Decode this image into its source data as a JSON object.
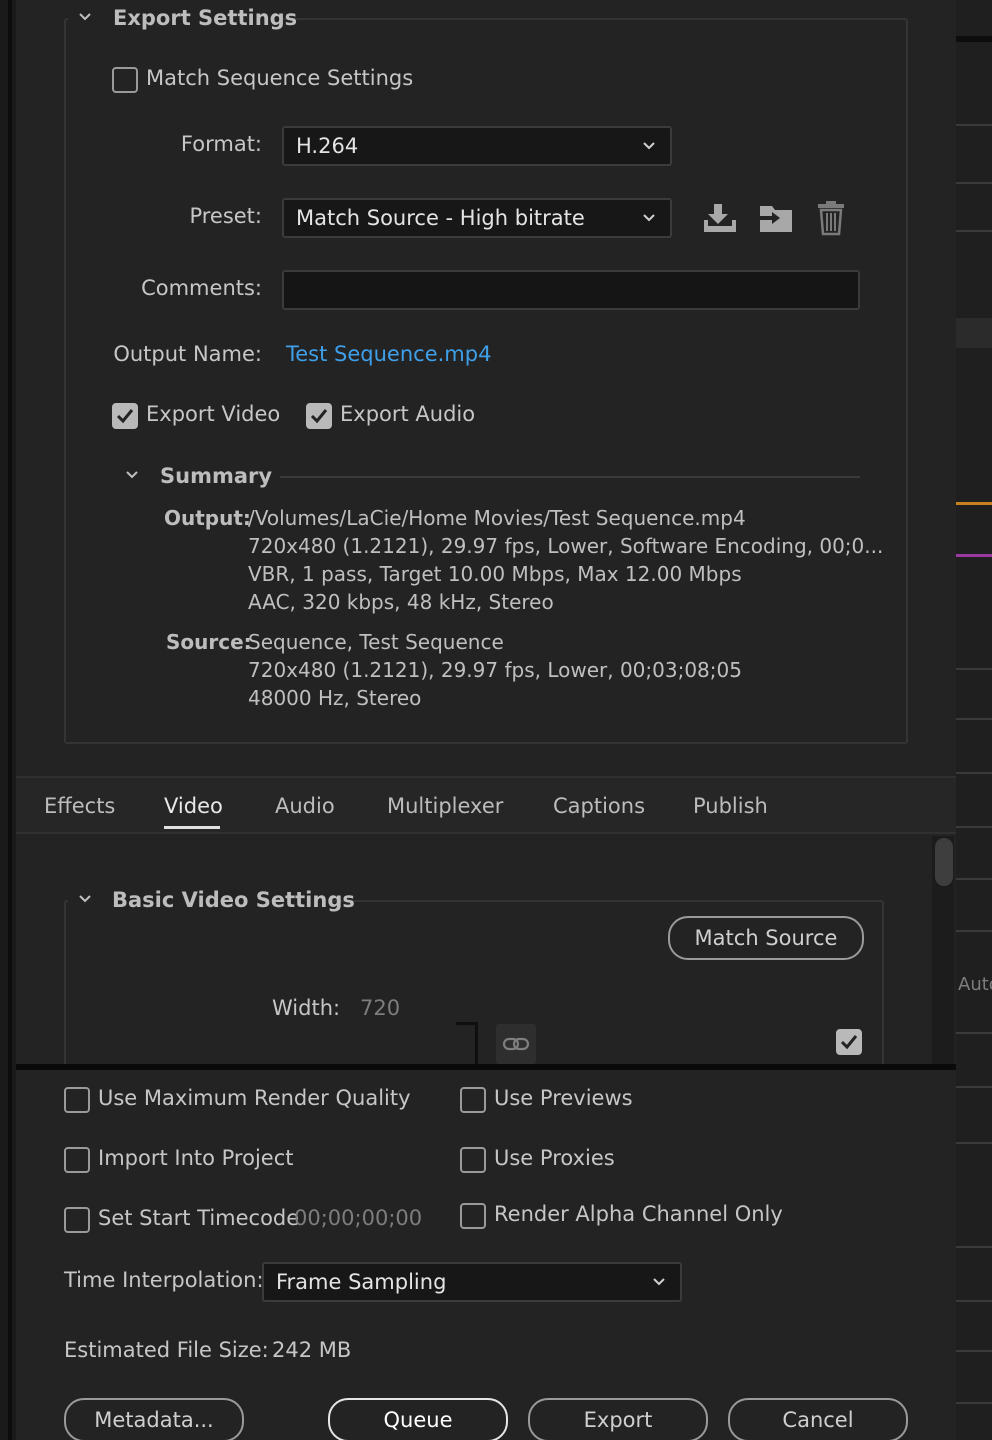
{
  "export_settings": {
    "title": "Export Settings",
    "match_sequence_settings": {
      "label": "Match Sequence Settings",
      "checked": false
    },
    "format": {
      "label": "Format:",
      "value": "H.264"
    },
    "preset": {
      "label": "Preset:",
      "value": "Match Source - High bitrate"
    },
    "comments": {
      "label": "Comments:",
      "value": ""
    },
    "output_name": {
      "label": "Output Name:",
      "value": "Test Sequence.mp4"
    },
    "export_video": {
      "label": "Export Video",
      "checked": true
    },
    "export_audio": {
      "label": "Export Audio",
      "checked": true
    },
    "summary": {
      "title": "Summary",
      "output_key": "Output:",
      "output_lines": [
        "/Volumes/LaCie/Home Movies/Test Sequence.mp4",
        "720x480 (1.2121), 29.97 fps, Lower, Software Encoding, 00;0...",
        "VBR, 1 pass, Target 10.00 Mbps, Max 12.00 Mbps",
        "AAC, 320 kbps, 48 kHz, Stereo"
      ],
      "source_key": "Source:",
      "source_lines": [
        "Sequence, Test Sequence",
        "720x480 (1.2121), 29.97 fps, Lower, 00;03;08;05",
        "48000 Hz, Stereo"
      ]
    }
  },
  "tabs": [
    "Effects",
    "Video",
    "Audio",
    "Multiplexer",
    "Captions",
    "Publish"
  ],
  "active_tab": "Video",
  "basic_video": {
    "title": "Basic Video Settings",
    "match_source_label": "Match Source",
    "width_label": "Width:",
    "width_value": "720"
  },
  "right_strip_text": "Auto",
  "options": {
    "use_max_render_quality": "Use Maximum Render Quality",
    "use_previews": "Use Previews",
    "import_into_project": "Import Into Project",
    "use_proxies": "Use Proxies",
    "set_start_timecode": "Set Start Timecode",
    "start_timecode_value": "00;00;00;00",
    "render_alpha_only": "Render Alpha Channel Only"
  },
  "time_interpolation": {
    "label": "Time Interpolation:",
    "value": "Frame Sampling"
  },
  "estimated_file_size": {
    "label": "Estimated File Size:",
    "value": "242 MB"
  },
  "buttons": {
    "metadata": "Metadata...",
    "queue": "Queue",
    "export": "Export",
    "cancel": "Cancel"
  },
  "colors": {
    "link": "#3f9fe8",
    "background": "#232323",
    "accent_orange": "#c8801e",
    "accent_purple": "#9a3aa0"
  }
}
